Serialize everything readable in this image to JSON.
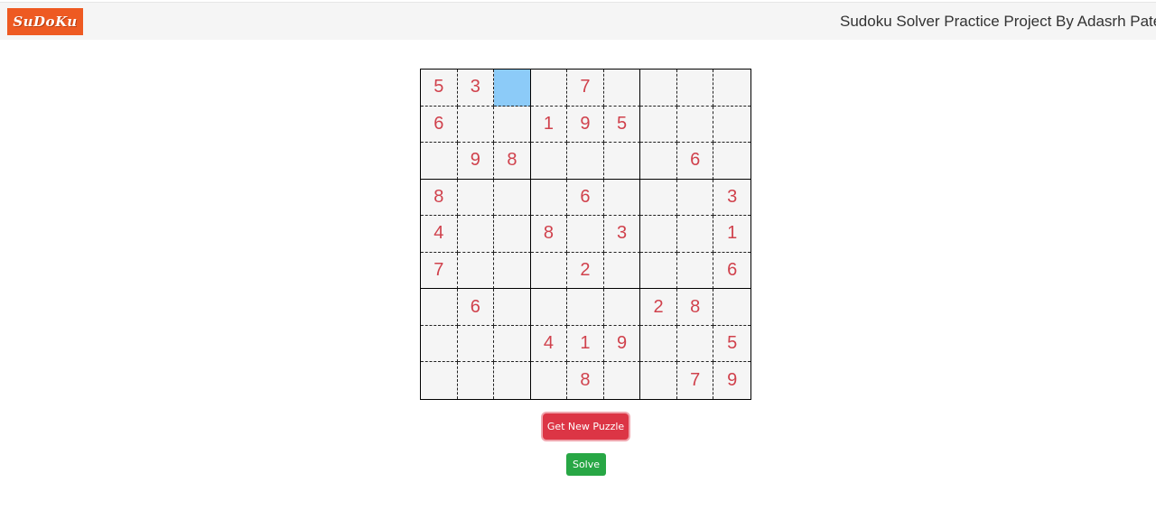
{
  "header": {
    "logo_text": "SuDoKu",
    "title": "Sudoku Solver Practice Project By Adasrh Patel"
  },
  "board": {
    "selected": [
      0,
      2
    ],
    "rows": [
      [
        "5",
        "3",
        "",
        "",
        "7",
        "",
        "",
        "",
        ""
      ],
      [
        "6",
        "",
        "",
        "1",
        "9",
        "5",
        "",
        "",
        ""
      ],
      [
        "",
        "9",
        "8",
        "",
        "",
        "",
        "",
        "6",
        ""
      ],
      [
        "8",
        "",
        "",
        "",
        "6",
        "",
        "",
        "",
        "3"
      ],
      [
        "4",
        "",
        "",
        "8",
        "",
        "3",
        "",
        "",
        "1"
      ],
      [
        "7",
        "",
        "",
        "",
        "2",
        "",
        "",
        "",
        "6"
      ],
      [
        "",
        "6",
        "",
        "",
        "",
        "",
        "2",
        "8",
        ""
      ],
      [
        "",
        "",
        "",
        "4",
        "1",
        "9",
        "",
        "",
        "5"
      ],
      [
        "",
        "",
        "",
        "",
        "8",
        "",
        "",
        "7",
        "9"
      ]
    ]
  },
  "buttons": {
    "new_puzzle": "Get New Puzzle",
    "solve": "Solve"
  },
  "colors": {
    "digit": "#d0414c",
    "selected_cell": "#8ccbf8",
    "logo_bg": "#ee5a22",
    "new_puzzle_bg": "#dc3545",
    "solve_bg": "#28a745"
  }
}
